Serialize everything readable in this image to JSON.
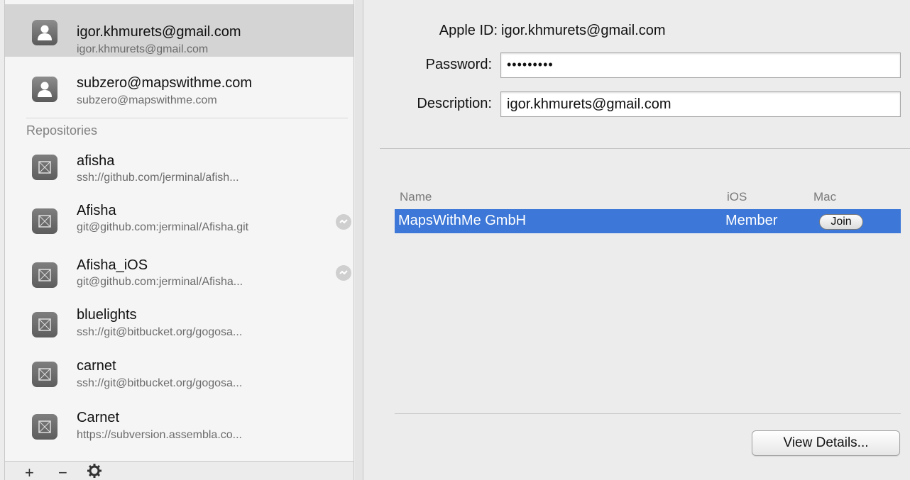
{
  "sidebar": {
    "accounts": [
      {
        "title": "igor.khmurets@gmail.com",
        "subtitle": "igor.khmurets@gmail.com",
        "selected": true,
        "icon": "person-icon"
      },
      {
        "title": "subzero@mapswithme.com",
        "subtitle": "subzero@mapswithme.com",
        "selected": false,
        "icon": "person-icon"
      }
    ],
    "section_header": "Repositories",
    "repositories": [
      {
        "title": "afisha",
        "subtitle": "ssh://github.com/jerminal/afish...",
        "status_icon": false
      },
      {
        "title": "Afisha",
        "subtitle": "git@github.com:jerminal/Afisha.git",
        "status_icon": true
      },
      {
        "title": "Afisha_iOS",
        "subtitle": "git@github.com:jerminal/Afisha...",
        "status_icon": true
      },
      {
        "title": "bluelights",
        "subtitle": "ssh://git@bitbucket.org/gogosa...",
        "status_icon": false
      },
      {
        "title": "carnet",
        "subtitle": "ssh://git@bitbucket.org/gogosa...",
        "status_icon": false
      },
      {
        "title": "Carnet",
        "subtitle": "https://subversion.assembla.co...",
        "status_icon": false
      }
    ],
    "footer": {
      "add": "+",
      "remove": "−"
    }
  },
  "account_form": {
    "apple_id_label": "Apple ID:",
    "apple_id_value": "igor.khmurets@gmail.com",
    "password_label": "Password:",
    "password_value": "•••••••••",
    "description_label": "Description:",
    "description_value": "igor.khmurets@gmail.com"
  },
  "teams_table": {
    "columns": [
      "Name",
      "iOS",
      "Mac"
    ],
    "rows": [
      {
        "name": "MapsWithMe GmbH",
        "ios": "Member",
        "mac": "Join",
        "selected": true
      }
    ]
  },
  "view_details_label": "View Details...",
  "colors": {
    "selection_blue": "#3d78d8",
    "sidebar_selected": "#d4d4d4"
  }
}
